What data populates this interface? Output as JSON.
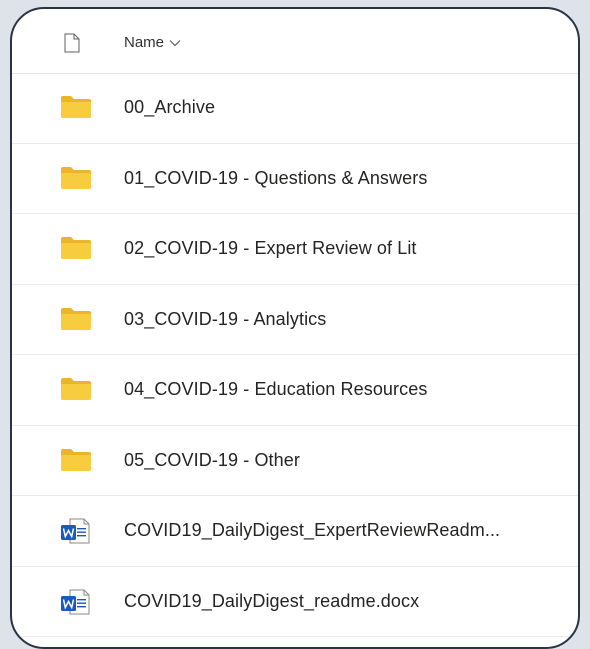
{
  "header": {
    "column_name": "Name"
  },
  "colors": {
    "folder": "#F8CC3F",
    "folder_back": "#EAB52A",
    "word_blue": "#185ABD",
    "border": "#2a3244",
    "background": "#dde3e9"
  },
  "items": [
    {
      "type": "folder",
      "icon": "folder-icon",
      "label": "00_Archive"
    },
    {
      "type": "folder",
      "icon": "folder-icon",
      "label": "01_COVID-19 - Questions & Answers"
    },
    {
      "type": "folder",
      "icon": "folder-icon",
      "label": "02_COVID-19 - Expert Review of Lit"
    },
    {
      "type": "folder",
      "icon": "folder-icon",
      "label": "03_COVID-19 - Analytics"
    },
    {
      "type": "folder",
      "icon": "folder-icon",
      "label": "04_COVID-19 - Education Resources"
    },
    {
      "type": "folder",
      "icon": "folder-icon",
      "label": "05_COVID-19 - Other"
    },
    {
      "type": "word",
      "icon": "word-doc-icon",
      "label": "COVID19_DailyDigest_ExpertReviewReadm..."
    },
    {
      "type": "word",
      "icon": "word-doc-icon",
      "label": "COVID19_DailyDigest_readme.docx"
    }
  ]
}
